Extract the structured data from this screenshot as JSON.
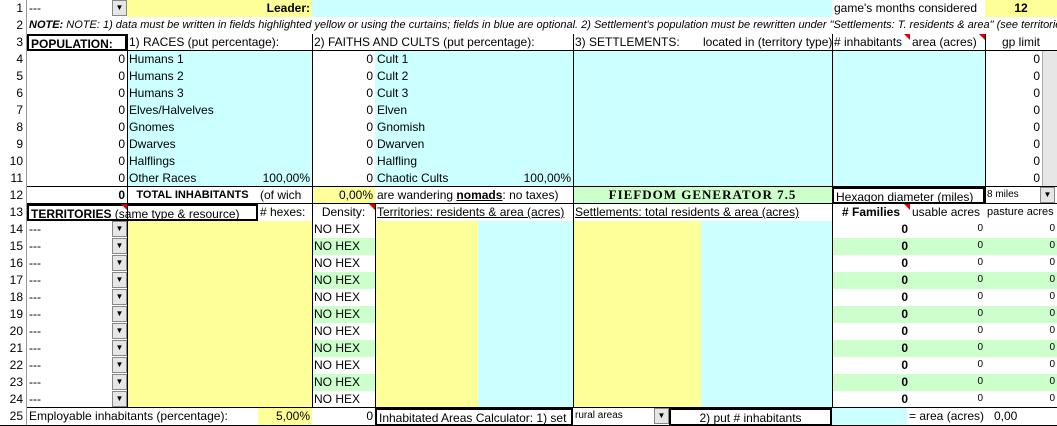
{
  "rownums": [
    "1",
    "2",
    "3",
    "4",
    "5",
    "6",
    "7",
    "8",
    "9",
    "10",
    "11",
    "12",
    "13",
    "14",
    "15",
    "16",
    "17",
    "18",
    "19",
    "20",
    "21",
    "22",
    "23",
    "24",
    "25"
  ],
  "dropdown_placeholder": "---",
  "row1": {
    "leader_label": "Leader:",
    "months_label": "game's months considered",
    "months_value": "12"
  },
  "note": "NOTE: 1) data must be written in fields highlighted yellow or using the curtains; fields in blue are optional. 2) Settlement's population must be rewritten under \"Settlements: T. residents & area\" (see territories).",
  "headers": {
    "population": "POPULATION:",
    "races": "1) RACES (put percentage):",
    "faiths": "2) FAITHS AND CULTS (put percentage):",
    "settlements": "3) SETTLEMENTS:",
    "located": "located in (territory type)",
    "inhabitants": "# inhabitants",
    "area": "area (acres)",
    "gp_limit": "gp limit"
  },
  "races": [
    {
      "value": "0",
      "name": "Humans 1"
    },
    {
      "value": "0",
      "name": "Humans 2"
    },
    {
      "value": "0",
      "name": "Humans 3"
    },
    {
      "value": "0",
      "name": "Elves/Halvelves"
    },
    {
      "value": "0",
      "name": "Gnomes"
    },
    {
      "value": "0",
      "name": "Dwarves"
    },
    {
      "value": "0",
      "name": "Halflings"
    },
    {
      "value": "0",
      "name": "Other Races",
      "pct": "100,00%"
    }
  ],
  "faiths": [
    {
      "value": "0",
      "name": "Cult 1"
    },
    {
      "value": "0",
      "name": "Cult 2"
    },
    {
      "value": "0",
      "name": "Cult 3"
    },
    {
      "value": "0",
      "name": "Elven"
    },
    {
      "value": "0",
      "name": "Gnomish"
    },
    {
      "value": "0",
      "name": "Dwarven"
    },
    {
      "value": "0",
      "name": "Halfling"
    },
    {
      "value": "0",
      "name": "Chaotic Cults",
      "pct": "100,00%"
    }
  ],
  "gp_values": [
    "0",
    "0",
    "0",
    "0",
    "0",
    "0",
    "0",
    "0"
  ],
  "row12": {
    "total_value": "0",
    "total_label": "TOTAL INHABITANTS",
    "of_which": "(of wich",
    "nomads_pct": "0,00%",
    "nomads_pre": "are wandering",
    "nomads_word": "nomads",
    "nomads_post": ": no taxes)",
    "title": "FIEFDOM GENERATOR 7.5",
    "hex_label": "Hexagon diameter (miles)",
    "hex_value": "8 miles"
  },
  "row13": {
    "territories": "TERRITORIES",
    "territories_sub": " (same type & resource)",
    "hexes": "# hexes:",
    "density": "Density:",
    "terr_res": "Territories: residents & area (acres)",
    "sett_res": "Settlements: total residents & area (acres)",
    "families": "# Families",
    "usable": "usable acres",
    "pasture": "pasture acres"
  },
  "territory_rows": [
    {
      "density": "NO HEX",
      "families": "0",
      "usable": "0",
      "pasture": "0"
    },
    {
      "density": "NO HEX",
      "families": "0",
      "usable": "0",
      "pasture": "0"
    },
    {
      "density": "NO HEX",
      "families": "0",
      "usable": "0",
      "pasture": "0"
    },
    {
      "density": "NO HEX",
      "families": "0",
      "usable": "0",
      "pasture": "0"
    },
    {
      "density": "NO HEX",
      "families": "0",
      "usable": "0",
      "pasture": "0"
    },
    {
      "density": "NO HEX",
      "families": "0",
      "usable": "0",
      "pasture": "0"
    },
    {
      "density": "NO HEX",
      "families": "0",
      "usable": "0",
      "pasture": "0"
    },
    {
      "density": "NO HEX",
      "families": "0",
      "usable": "0",
      "pasture": "0"
    },
    {
      "density": "NO HEX",
      "families": "0",
      "usable": "0",
      "pasture": "0"
    },
    {
      "density": "NO HEX",
      "families": "0",
      "usable": "0",
      "pasture": "0"
    },
    {
      "density": "NO HEX",
      "families": "0",
      "usable": "0",
      "pasture": "0"
    }
  ],
  "row25": {
    "employable": "Employable inhabitants (percentage):",
    "employable_pct": "5,00%",
    "employable_val": "0",
    "calc_label": "Inhabitated Areas Calculator: 1) set",
    "calc_select": "rural areas",
    "calc_step2": "2) put # inhabitants",
    "calc_result_label": "= area (acres)",
    "calc_result": "0,00"
  },
  "colors": {
    "yellow": "#ffff99",
    "blue": "#ccffff",
    "green": "#ccffcc"
  },
  "icons": {
    "dropdown": "triangle-down-icon",
    "comment": "red-corner-comment-icon"
  }
}
